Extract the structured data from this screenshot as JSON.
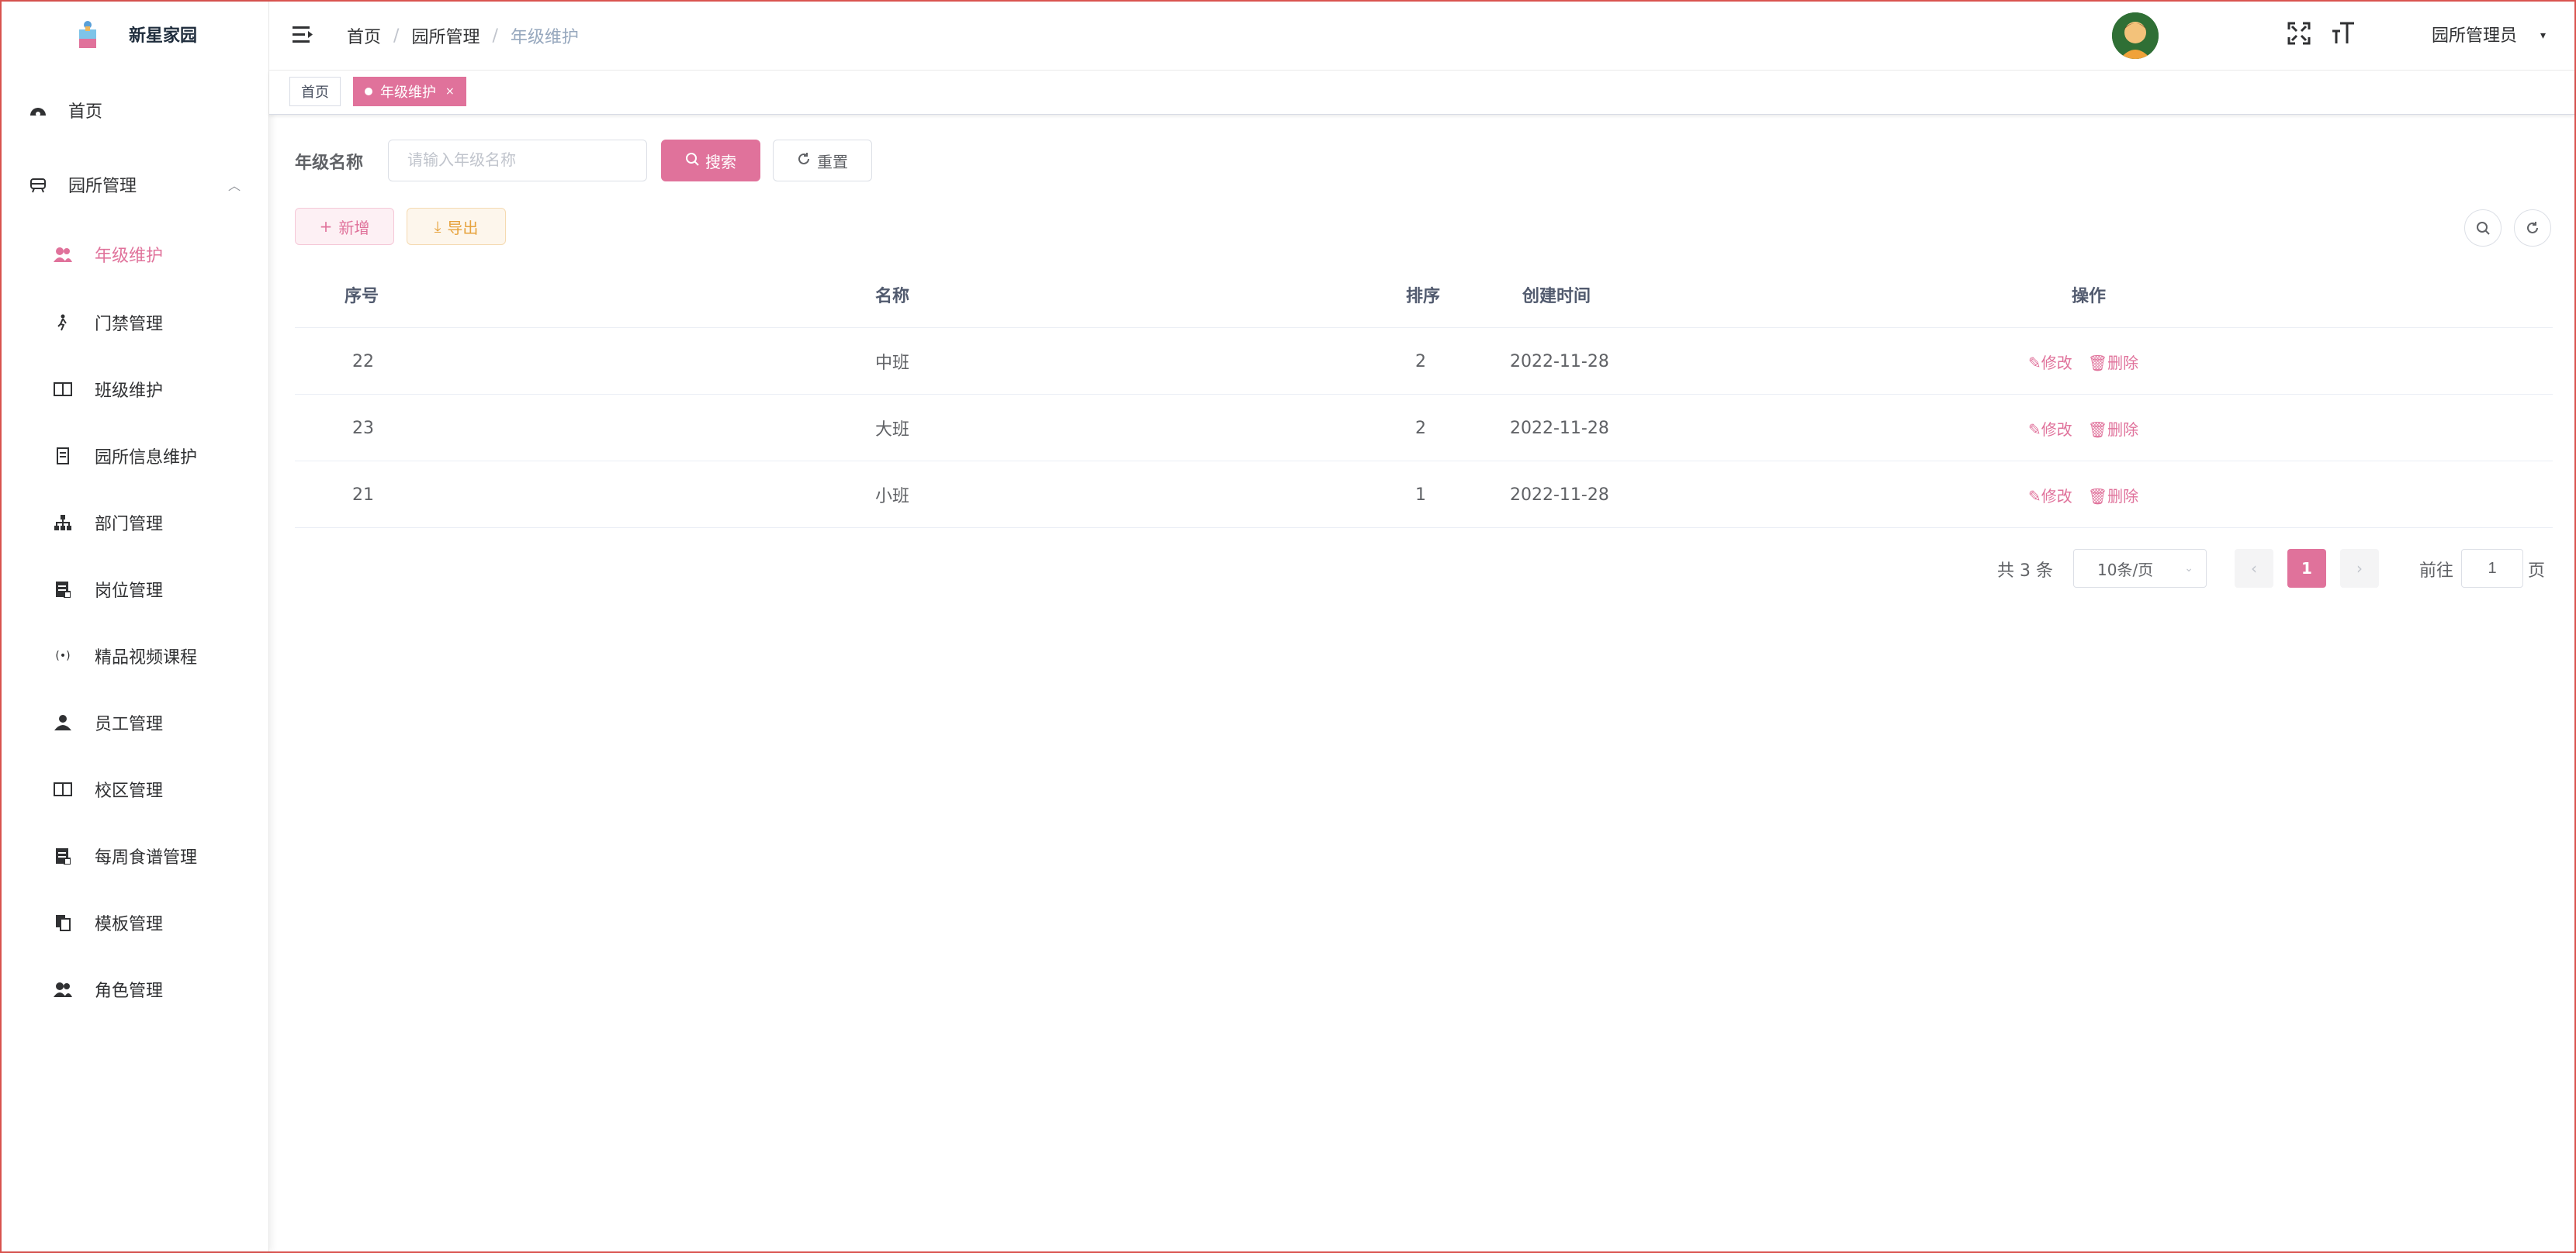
{
  "app": {
    "title": "新星家园"
  },
  "colors": {
    "accent": "#e0729b",
    "warning": "#e6a23c"
  },
  "sidebar": {
    "items": [
      {
        "label": "首页",
        "icon": "dashboard-icon"
      },
      {
        "label": "园所管理",
        "icon": "building-icon",
        "expanded": true
      },
      {
        "label": "年级维护",
        "icon": "users-icon",
        "active": true
      },
      {
        "label": "门禁管理",
        "icon": "person-walk-icon"
      },
      {
        "label": "班级维护",
        "icon": "book-icon"
      },
      {
        "label": "园所信息维护",
        "icon": "document-icon"
      },
      {
        "label": "部门管理",
        "icon": "tree-icon"
      },
      {
        "label": "岗位管理",
        "icon": "list-icon"
      },
      {
        "label": "精品视频课程",
        "icon": "broadcast-icon"
      },
      {
        "label": "员工管理",
        "icon": "user-icon"
      },
      {
        "label": "校区管理",
        "icon": "book-icon"
      },
      {
        "label": "每周食谱管理",
        "icon": "list-icon"
      },
      {
        "label": "模板管理",
        "icon": "copy-icon"
      },
      {
        "label": "角色管理",
        "icon": "users-icon"
      }
    ]
  },
  "navbar": {
    "breadcrumb": [
      "首页",
      "园所管理",
      "年级维护"
    ],
    "user_name": "园所管理员"
  },
  "tags": [
    {
      "label": "首页",
      "active": false
    },
    {
      "label": "年级维护",
      "active": true
    }
  ],
  "search": {
    "label": "年级名称",
    "placeholder": "请输入年级名称",
    "value": "",
    "search_button": "搜索",
    "reset_button": "重置"
  },
  "toolbar": {
    "add_button": "新增",
    "export_button": "导出"
  },
  "table": {
    "columns": [
      "序号",
      "名称",
      "排序",
      "创建时间",
      "操作"
    ],
    "rows": [
      {
        "id": "22",
        "name": "中班",
        "sort": "2",
        "created": "2022-11-28"
      },
      {
        "id": "23",
        "name": "大班",
        "sort": "2",
        "created": "2022-11-28"
      },
      {
        "id": "21",
        "name": "小班",
        "sort": "1",
        "created": "2022-11-28"
      }
    ],
    "edit_label": "修改",
    "delete_label": "删除"
  },
  "pagination": {
    "total": "共 3 条",
    "page_size": "10条/页",
    "current_page": "1",
    "goto_label": "前往",
    "goto_value": "1",
    "goto_unit": "页"
  }
}
